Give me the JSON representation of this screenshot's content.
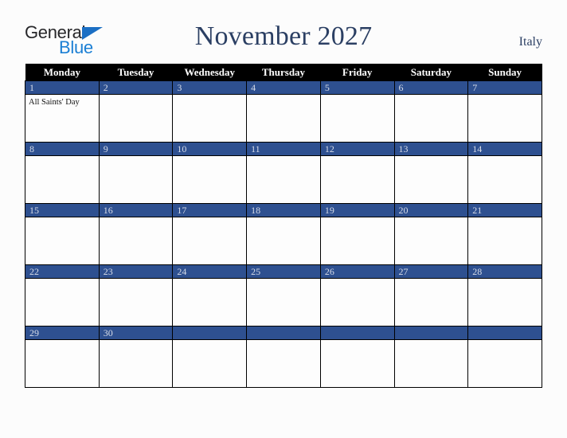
{
  "brand": {
    "name_part1": "General",
    "name_part2": "Blue",
    "triangle_icon": "triangle-icon",
    "color_dark": "#27272a",
    "color_blue": "#1b7fd4"
  },
  "header": {
    "title": "November 2027",
    "country": "Italy",
    "title_color": "#2b3f63"
  },
  "calendar": {
    "weekday_headers": [
      "Monday",
      "Tuesday",
      "Wednesday",
      "Thursday",
      "Friday",
      "Saturday",
      "Sunday"
    ],
    "header_bg": "#000000",
    "daynum_bg": "#2e5090",
    "daynum_color": "#d7dce8",
    "cell_bg": "#fdfdfd",
    "border_color": "#000000",
    "weeks": [
      [
        {
          "day": "1",
          "events": [
            "All Saints' Day"
          ]
        },
        {
          "day": "2",
          "events": []
        },
        {
          "day": "3",
          "events": []
        },
        {
          "day": "4",
          "events": []
        },
        {
          "day": "5",
          "events": []
        },
        {
          "day": "6",
          "events": []
        },
        {
          "day": "7",
          "events": []
        }
      ],
      [
        {
          "day": "8",
          "events": []
        },
        {
          "day": "9",
          "events": []
        },
        {
          "day": "10",
          "events": []
        },
        {
          "day": "11",
          "events": []
        },
        {
          "day": "12",
          "events": []
        },
        {
          "day": "13",
          "events": []
        },
        {
          "day": "14",
          "events": []
        }
      ],
      [
        {
          "day": "15",
          "events": []
        },
        {
          "day": "16",
          "events": []
        },
        {
          "day": "17",
          "events": []
        },
        {
          "day": "18",
          "events": []
        },
        {
          "day": "19",
          "events": []
        },
        {
          "day": "20",
          "events": []
        },
        {
          "day": "21",
          "events": []
        }
      ],
      [
        {
          "day": "22",
          "events": []
        },
        {
          "day": "23",
          "events": []
        },
        {
          "day": "24",
          "events": []
        },
        {
          "day": "25",
          "events": []
        },
        {
          "day": "26",
          "events": []
        },
        {
          "day": "27",
          "events": []
        },
        {
          "day": "28",
          "events": []
        }
      ],
      [
        {
          "day": "29",
          "events": []
        },
        {
          "day": "30",
          "events": []
        },
        {
          "day": "",
          "events": []
        },
        {
          "day": "",
          "events": []
        },
        {
          "day": "",
          "events": []
        },
        {
          "day": "",
          "events": []
        },
        {
          "day": "",
          "events": []
        }
      ]
    ]
  }
}
